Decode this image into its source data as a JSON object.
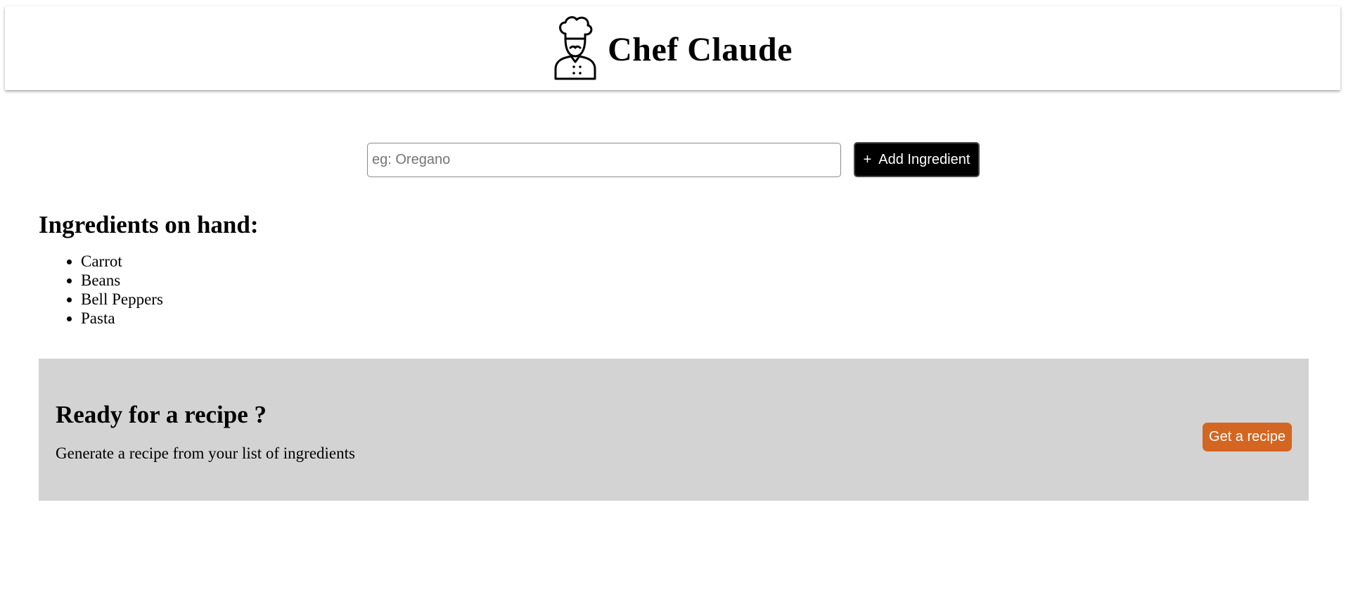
{
  "header": {
    "title": "Chef Claude",
    "logo_icon": "chef-icon"
  },
  "form": {
    "input_value": "",
    "input_placeholder": "eg: Oregano",
    "add_button_icon": "+",
    "add_button_label": "Add Ingredient"
  },
  "ingredients": {
    "heading": "Ingredients on hand:",
    "items": [
      "Carrot",
      "Beans",
      "Bell Peppers",
      "Pasta"
    ]
  },
  "recipe_panel": {
    "heading": "Ready for a recipe ?",
    "description": "Generate a recipe from your list of ingredients",
    "button_label": "Get a recipe",
    "background_color": "#d3d3d3",
    "button_color": "#d26622"
  }
}
